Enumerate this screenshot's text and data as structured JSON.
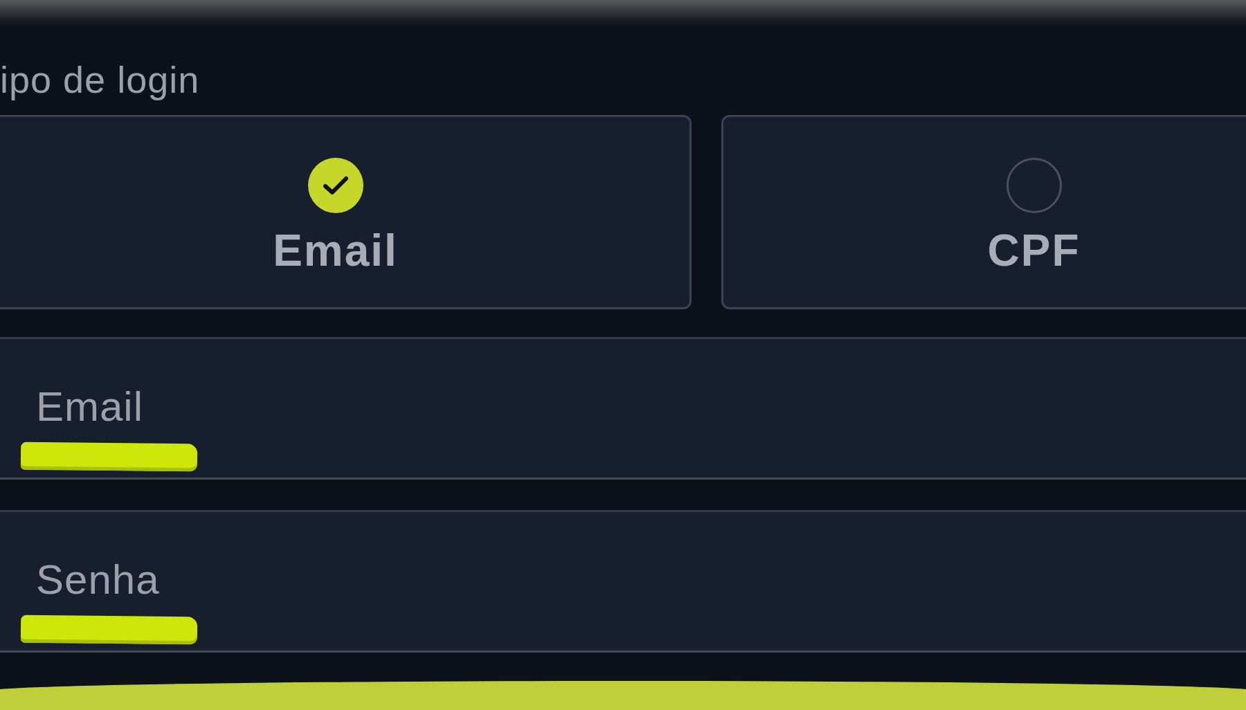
{
  "login_type": {
    "label": "ipo de login",
    "options": [
      {
        "label": "Email",
        "selected": true
      },
      {
        "label": "CPF",
        "selected": false
      }
    ]
  },
  "fields": [
    {
      "label": "Email",
      "highlighted": true
    },
    {
      "label": "Senha",
      "highlighted": true
    }
  ]
}
